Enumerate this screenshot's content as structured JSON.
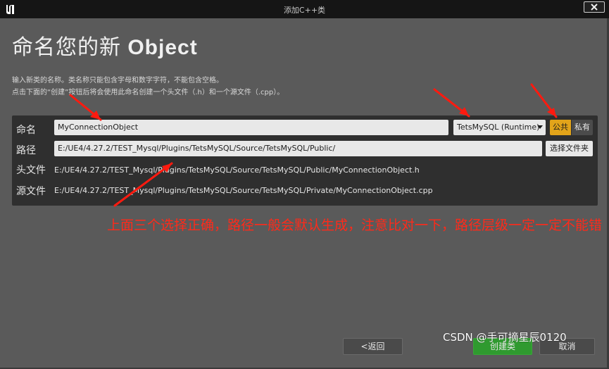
{
  "window": {
    "title": "添加C++类",
    "logo_icon": "unreal-logo-icon",
    "close_icon": "close-icon"
  },
  "heading": {
    "prefix": "命名您的新 ",
    "class_word": "Object"
  },
  "description": {
    "line1": "输入新类的名称。类名称只能包含字母和数字字符，不能包含空格。",
    "line2": "点击下面的“创建”按钮后将会使用此命名创建一个头文件（.h）和一个源文件（.cpp）。"
  },
  "form": {
    "name_label": "命名",
    "name_value": "MyConnectionObject",
    "module_dropdown": "TetsMySQL (Runtime)",
    "public_label": "公共",
    "private_label": "私有",
    "path_label": "路径",
    "path_value": "E:/UE4/4.27.2/TEST_Mysql/Plugins/TetsMySQL/Source/TetsMySQL/Public/",
    "choose_folder_label": "选择文件夹",
    "header_label": "头文件",
    "header_value": "E:/UE4/4.27.2/TEST_Mysql/Plugins/TetsMySQL/Source/TetsMySQL/Public/MyConnectionObject.h",
    "source_label": "源文件",
    "source_value": "E:/UE4/4.27.2/TEST_Mysql/Plugins/TetsMySQL/Source/TetsMySQL/Private/MyConnectionObject.cpp"
  },
  "annotation": {
    "text": "上面三个选择正确，路径一般会默认生成，注意比对一下，路径层级一定一定不能错",
    "color": "#ff2a1a"
  },
  "buttons": {
    "back": "<返回",
    "create": "创建类",
    "cancel": "取消"
  },
  "watermark": "CSDN @手可摘星辰0120",
  "colors": {
    "accent_public": "#e2a41a",
    "create_green": "#2f9a2f"
  }
}
